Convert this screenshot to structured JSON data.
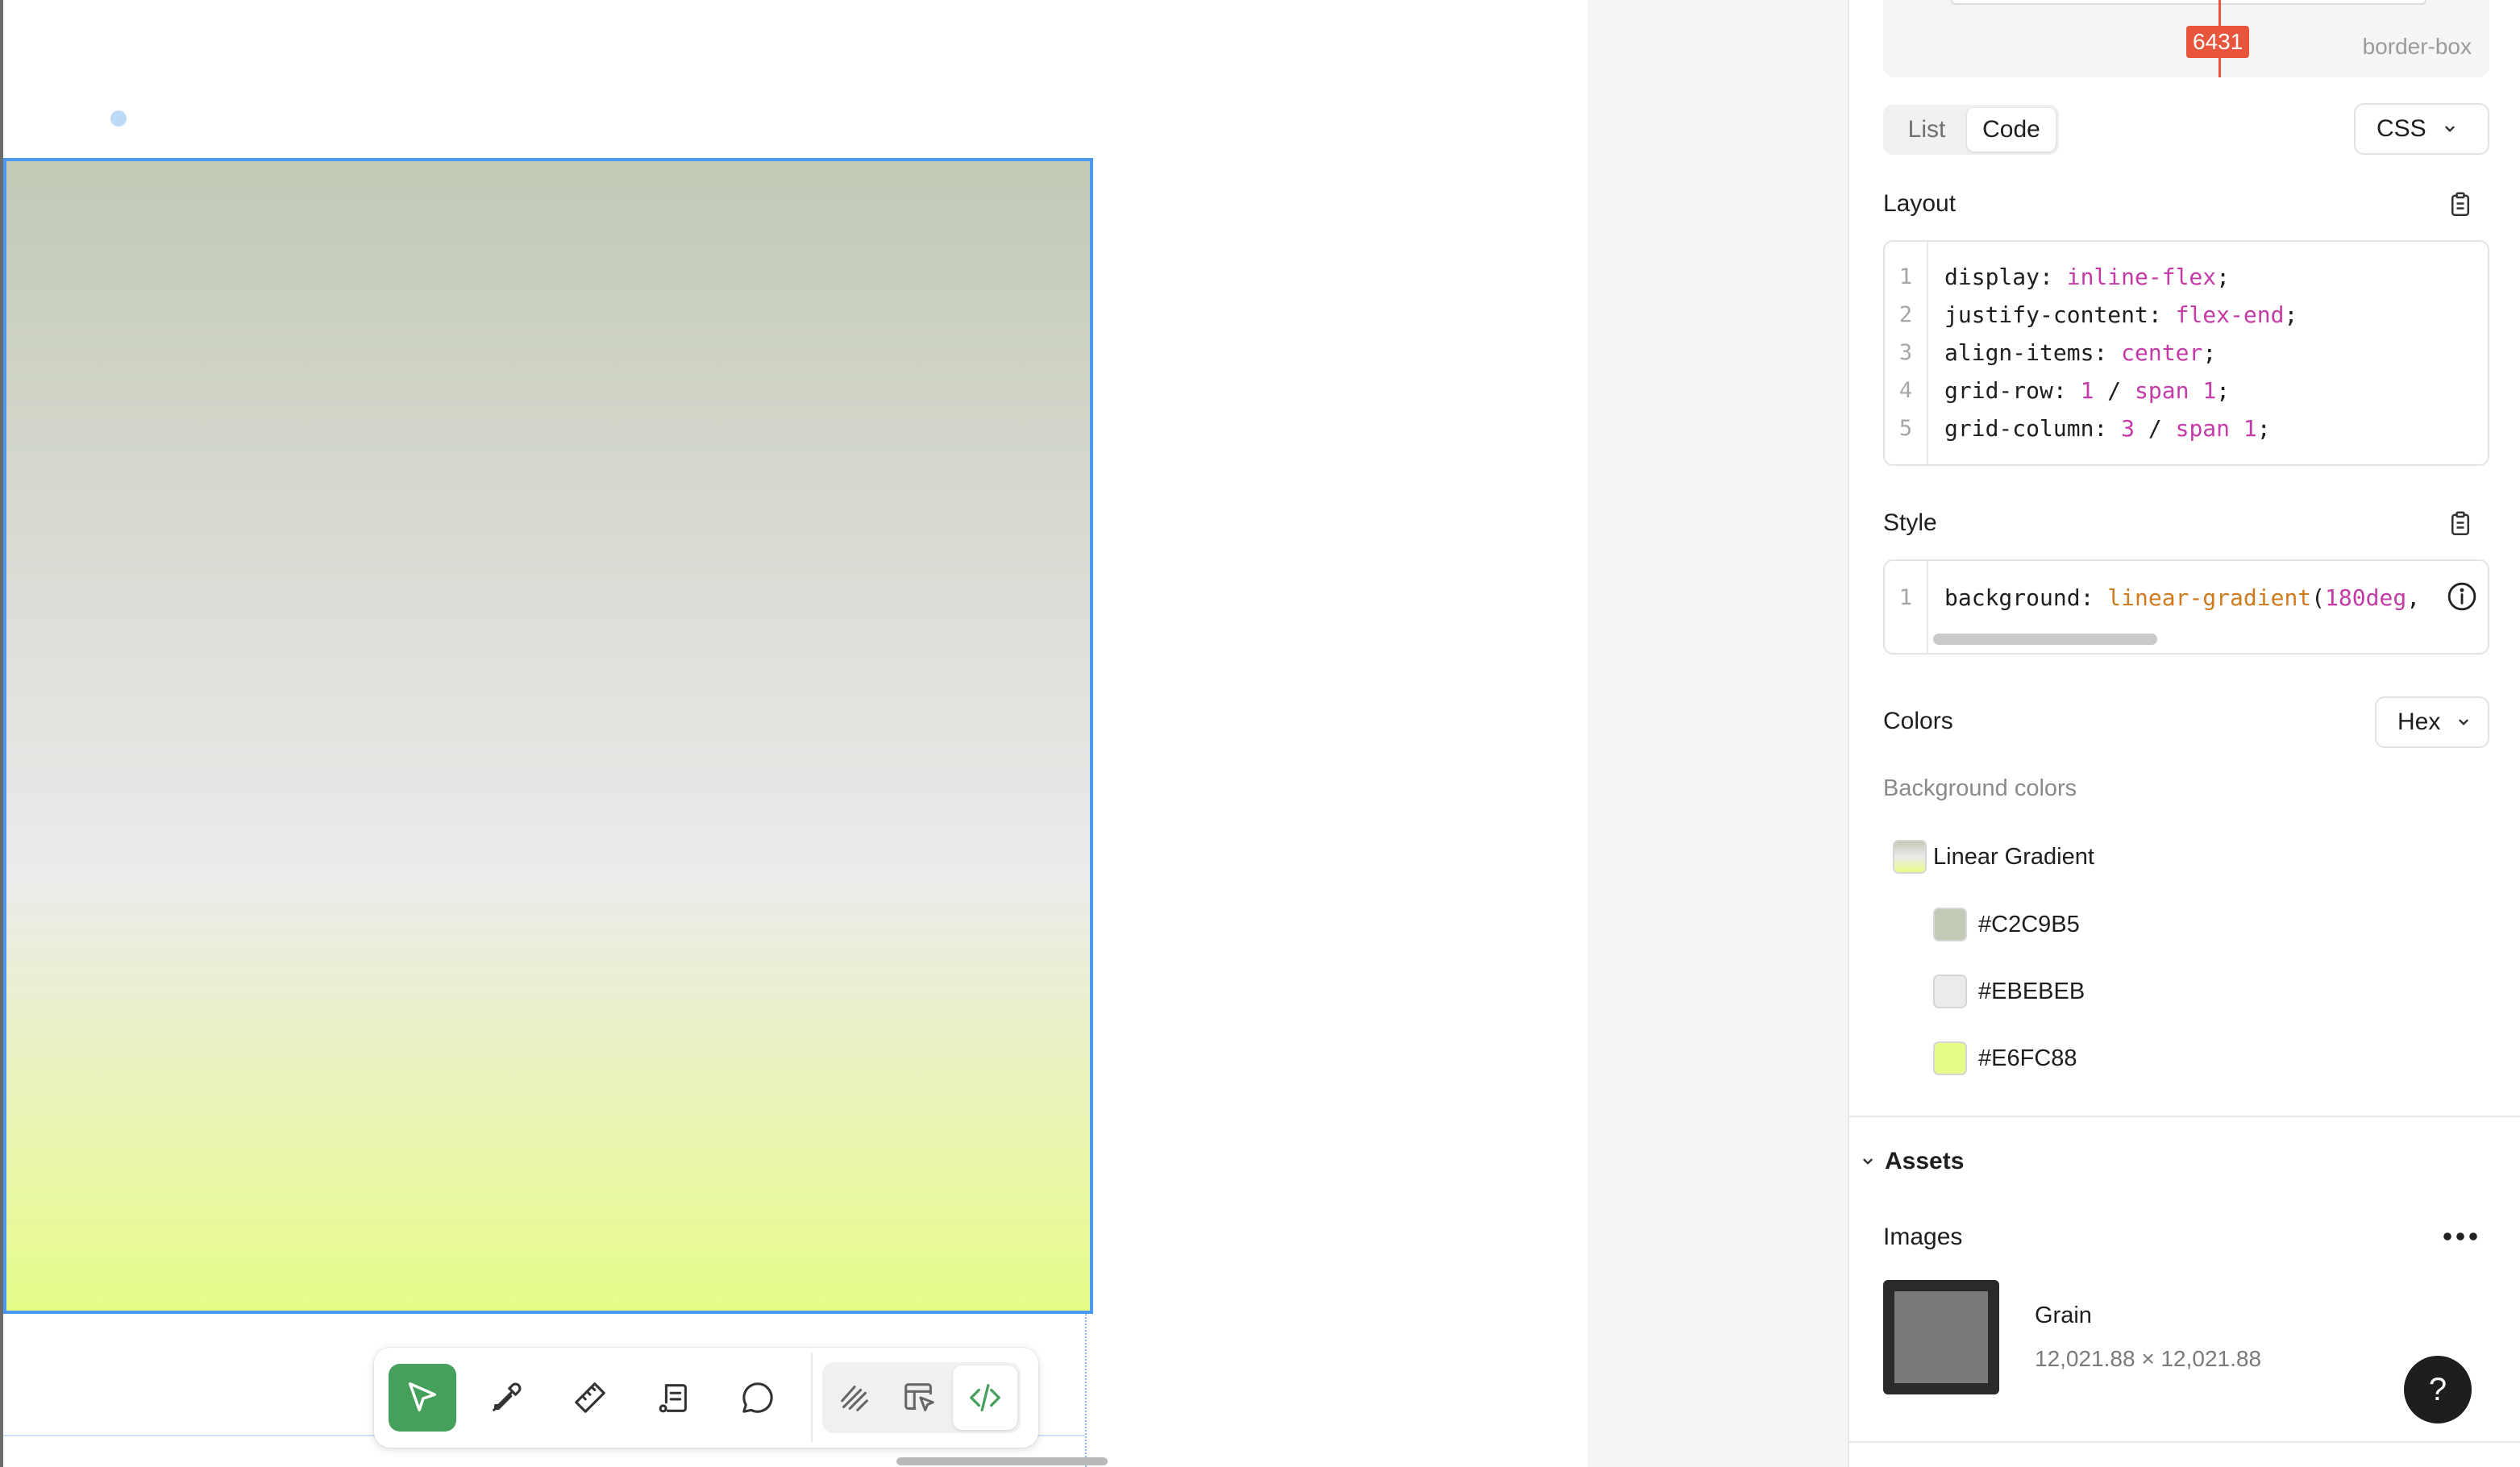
{
  "box_model": {
    "value": "6431",
    "mode": "border-box"
  },
  "code_view": {
    "tabs": [
      "List",
      "Code"
    ],
    "active_tab": "Code",
    "language": "CSS"
  },
  "layout": {
    "title": "Layout",
    "lines": [
      {
        "num": "1",
        "prop": "display: ",
        "parts": [
          {
            "t": "inline-flex",
            "c": "val"
          },
          {
            "t": ";",
            "c": ""
          }
        ]
      },
      {
        "num": "2",
        "prop": "justify-content: ",
        "parts": [
          {
            "t": "flex-end",
            "c": "val"
          },
          {
            "t": ";",
            "c": ""
          }
        ]
      },
      {
        "num": "3",
        "prop": "align-items: ",
        "parts": [
          {
            "t": "center",
            "c": "val"
          },
          {
            "t": ";",
            "c": ""
          }
        ]
      },
      {
        "num": "4",
        "prop": "grid-row: ",
        "parts": [
          {
            "t": "1",
            "c": "val"
          },
          {
            "t": " / ",
            "c": ""
          },
          {
            "t": "span",
            "c": "val"
          },
          {
            "t": " ",
            "c": ""
          },
          {
            "t": "1",
            "c": "val"
          },
          {
            "t": ";",
            "c": ""
          }
        ]
      },
      {
        "num": "5",
        "prop": "grid-column: ",
        "parts": [
          {
            "t": "3",
            "c": "val"
          },
          {
            "t": " / ",
            "c": ""
          },
          {
            "t": "span",
            "c": "val"
          },
          {
            "t": " ",
            "c": ""
          },
          {
            "t": "1",
            "c": "val"
          },
          {
            "t": ";",
            "c": ""
          }
        ]
      }
    ]
  },
  "style": {
    "title": "Style",
    "lines": [
      {
        "num": "1",
        "prop": "background: ",
        "parts": [
          {
            "t": "linear-gradient",
            "c": "fn"
          },
          {
            "t": "(",
            "c": ""
          },
          {
            "t": "180deg",
            "c": "val"
          },
          {
            "t": ",",
            "c": ""
          }
        ]
      }
    ]
  },
  "colors": {
    "title": "Colors",
    "format": "Hex",
    "subtitle": "Background colors",
    "gradient_label": "Linear Gradient",
    "stops": [
      {
        "hex": "#C2C9B5",
        "color": "#C2C9B5"
      },
      {
        "hex": "#EBEBEB",
        "color": "#EBEBEB"
      },
      {
        "hex": "#E6FC88",
        "color": "#E6FC88"
      }
    ]
  },
  "assets": {
    "title": "Assets",
    "images_title": "Images",
    "image_name": "Grain",
    "image_size": "12,021.88 × 12,021.88"
  },
  "help_label": "?",
  "theme": {
    "accent_green": "#45A05B",
    "selection_blue": "#4B98F0",
    "measure_red": "#E8553D"
  }
}
